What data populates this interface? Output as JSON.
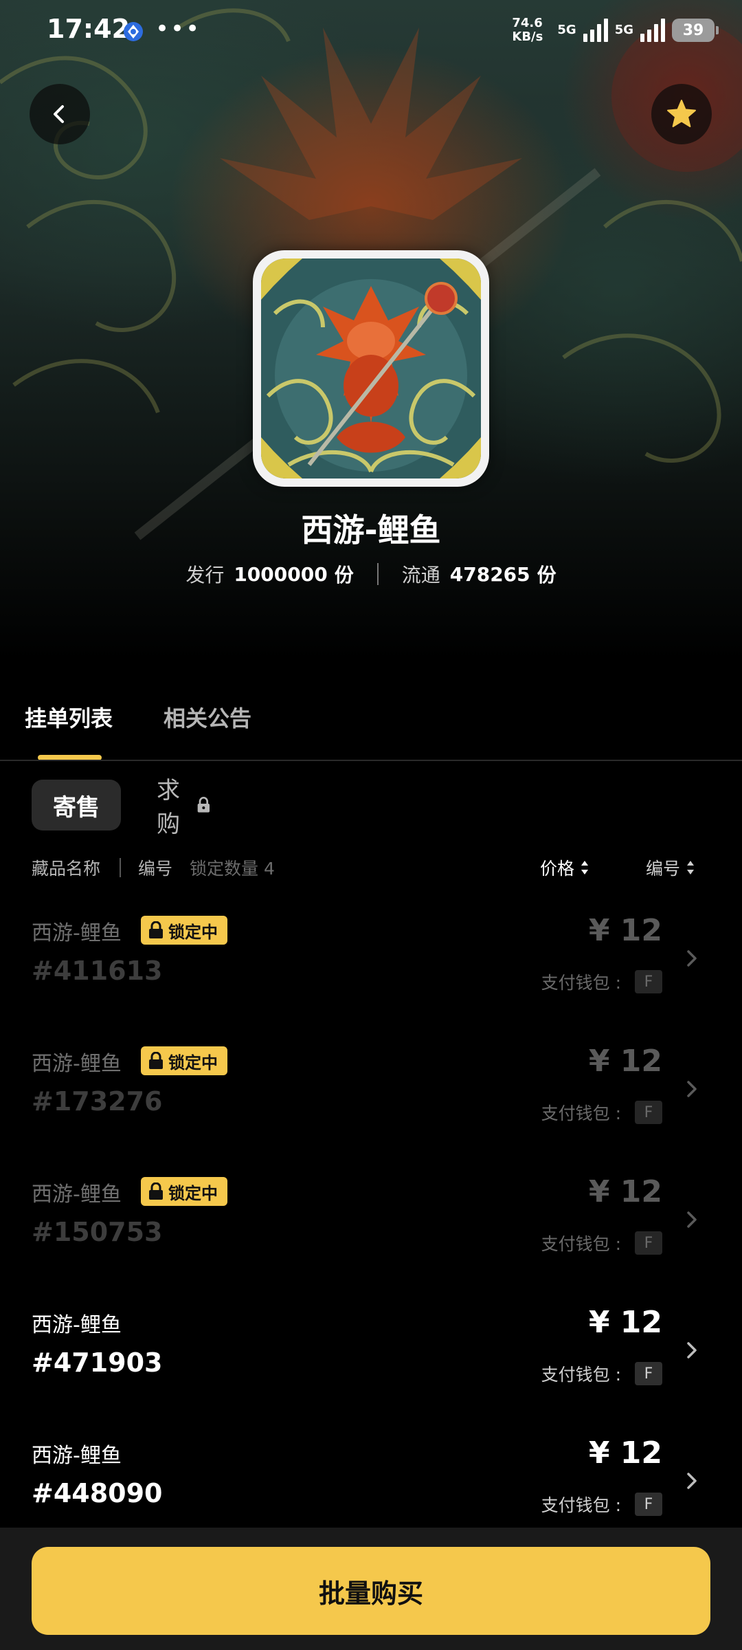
{
  "status_bar": {
    "time": "17:42",
    "net_speed_top": "74.6",
    "net_speed_bottom": "KB/s",
    "net_type_1": "5G",
    "net_type_2": "5G",
    "battery": "39",
    "more": "•••"
  },
  "header": {
    "back_icon": "chevron-left-icon",
    "favorite_icon": "star-icon",
    "accent_color": "#f5c84c"
  },
  "item": {
    "title": "西游-鲤鱼",
    "issue_label": "发行",
    "issue_value": "1000000",
    "issue_unit": "份",
    "circulation_label": "流通",
    "circulation_value": "478265",
    "circulation_unit": "份"
  },
  "tabs": [
    {
      "label": "挂单列表",
      "active": true
    },
    {
      "label": "相关公告",
      "active": false
    }
  ],
  "segment": {
    "sell": "寄售",
    "buy": "求购"
  },
  "filters": {
    "name": "藏品名称",
    "number": "编号",
    "locked": "锁定数量 4",
    "sort_price": "价格",
    "sort_number": "编号"
  },
  "listings": [
    {
      "name": "西游-鲤鱼",
      "number": "#411613",
      "badge": "锁定中",
      "price": "¥ 12",
      "wallet_label": "支付钱包 :",
      "wallet": "F",
      "locked": true
    },
    {
      "name": "西游-鲤鱼",
      "number": "#173276",
      "badge": "锁定中",
      "price": "¥ 12",
      "wallet_label": "支付钱包 :",
      "wallet": "F",
      "locked": true
    },
    {
      "name": "西游-鲤鱼",
      "number": "#150753",
      "badge": "锁定中",
      "price": "¥ 12",
      "wallet_label": "支付钱包 :",
      "wallet": "F",
      "locked": true
    },
    {
      "name": "西游-鲤鱼",
      "number": "#471903",
      "badge": "",
      "price": "¥ 12",
      "wallet_label": "支付钱包 :",
      "wallet": "F",
      "locked": false
    },
    {
      "name": "西游-鲤鱼",
      "number": "#448090",
      "badge": "",
      "price": "¥ 12",
      "wallet_label": "支付钱包 :",
      "wallet": "F",
      "locked": false
    }
  ],
  "footer": {
    "batch_buy": "批量购买"
  }
}
